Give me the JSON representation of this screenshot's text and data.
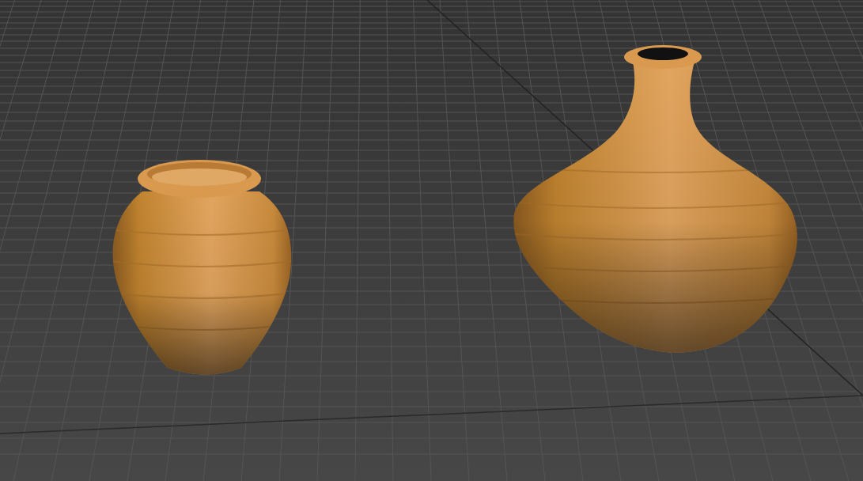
{
  "viewport": {
    "objects": [
      {
        "kind": "jar"
      },
      {
        "kind": "vase"
      }
    ]
  }
}
